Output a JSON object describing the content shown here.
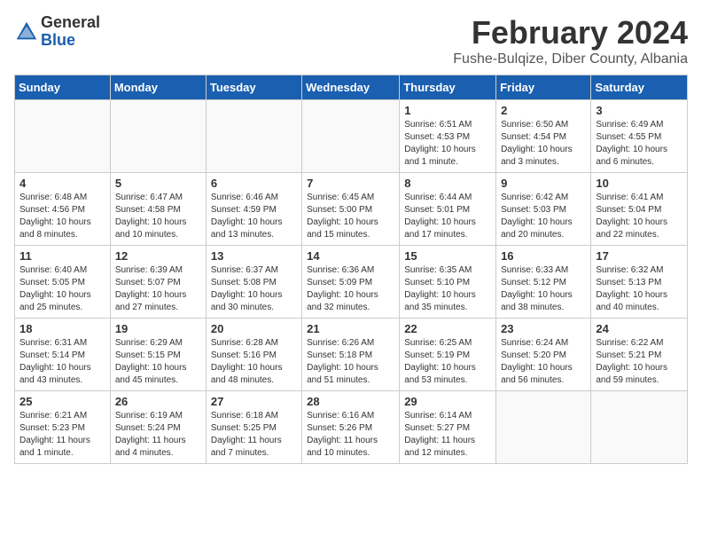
{
  "logo": {
    "general": "General",
    "blue": "Blue"
  },
  "title": "February 2024",
  "subtitle": "Fushe-Bulqize, Diber County, Albania",
  "days_of_week": [
    "Sunday",
    "Monday",
    "Tuesday",
    "Wednesday",
    "Thursday",
    "Friday",
    "Saturday"
  ],
  "weeks": [
    [
      {
        "day": "",
        "info": ""
      },
      {
        "day": "",
        "info": ""
      },
      {
        "day": "",
        "info": ""
      },
      {
        "day": "",
        "info": ""
      },
      {
        "day": "1",
        "info": "Sunrise: 6:51 AM\nSunset: 4:53 PM\nDaylight: 10 hours and 1 minute."
      },
      {
        "day": "2",
        "info": "Sunrise: 6:50 AM\nSunset: 4:54 PM\nDaylight: 10 hours and 3 minutes."
      },
      {
        "day": "3",
        "info": "Sunrise: 6:49 AM\nSunset: 4:55 PM\nDaylight: 10 hours and 6 minutes."
      }
    ],
    [
      {
        "day": "4",
        "info": "Sunrise: 6:48 AM\nSunset: 4:56 PM\nDaylight: 10 hours and 8 minutes."
      },
      {
        "day": "5",
        "info": "Sunrise: 6:47 AM\nSunset: 4:58 PM\nDaylight: 10 hours and 10 minutes."
      },
      {
        "day": "6",
        "info": "Sunrise: 6:46 AM\nSunset: 4:59 PM\nDaylight: 10 hours and 13 minutes."
      },
      {
        "day": "7",
        "info": "Sunrise: 6:45 AM\nSunset: 5:00 PM\nDaylight: 10 hours and 15 minutes."
      },
      {
        "day": "8",
        "info": "Sunrise: 6:44 AM\nSunset: 5:01 PM\nDaylight: 10 hours and 17 minutes."
      },
      {
        "day": "9",
        "info": "Sunrise: 6:42 AM\nSunset: 5:03 PM\nDaylight: 10 hours and 20 minutes."
      },
      {
        "day": "10",
        "info": "Sunrise: 6:41 AM\nSunset: 5:04 PM\nDaylight: 10 hours and 22 minutes."
      }
    ],
    [
      {
        "day": "11",
        "info": "Sunrise: 6:40 AM\nSunset: 5:05 PM\nDaylight: 10 hours and 25 minutes."
      },
      {
        "day": "12",
        "info": "Sunrise: 6:39 AM\nSunset: 5:07 PM\nDaylight: 10 hours and 27 minutes."
      },
      {
        "day": "13",
        "info": "Sunrise: 6:37 AM\nSunset: 5:08 PM\nDaylight: 10 hours and 30 minutes."
      },
      {
        "day": "14",
        "info": "Sunrise: 6:36 AM\nSunset: 5:09 PM\nDaylight: 10 hours and 32 minutes."
      },
      {
        "day": "15",
        "info": "Sunrise: 6:35 AM\nSunset: 5:10 PM\nDaylight: 10 hours and 35 minutes."
      },
      {
        "day": "16",
        "info": "Sunrise: 6:33 AM\nSunset: 5:12 PM\nDaylight: 10 hours and 38 minutes."
      },
      {
        "day": "17",
        "info": "Sunrise: 6:32 AM\nSunset: 5:13 PM\nDaylight: 10 hours and 40 minutes."
      }
    ],
    [
      {
        "day": "18",
        "info": "Sunrise: 6:31 AM\nSunset: 5:14 PM\nDaylight: 10 hours and 43 minutes."
      },
      {
        "day": "19",
        "info": "Sunrise: 6:29 AM\nSunset: 5:15 PM\nDaylight: 10 hours and 45 minutes."
      },
      {
        "day": "20",
        "info": "Sunrise: 6:28 AM\nSunset: 5:16 PM\nDaylight: 10 hours and 48 minutes."
      },
      {
        "day": "21",
        "info": "Sunrise: 6:26 AM\nSunset: 5:18 PM\nDaylight: 10 hours and 51 minutes."
      },
      {
        "day": "22",
        "info": "Sunrise: 6:25 AM\nSunset: 5:19 PM\nDaylight: 10 hours and 53 minutes."
      },
      {
        "day": "23",
        "info": "Sunrise: 6:24 AM\nSunset: 5:20 PM\nDaylight: 10 hours and 56 minutes."
      },
      {
        "day": "24",
        "info": "Sunrise: 6:22 AM\nSunset: 5:21 PM\nDaylight: 10 hours and 59 minutes."
      }
    ],
    [
      {
        "day": "25",
        "info": "Sunrise: 6:21 AM\nSunset: 5:23 PM\nDaylight: 11 hours and 1 minute."
      },
      {
        "day": "26",
        "info": "Sunrise: 6:19 AM\nSunset: 5:24 PM\nDaylight: 11 hours and 4 minutes."
      },
      {
        "day": "27",
        "info": "Sunrise: 6:18 AM\nSunset: 5:25 PM\nDaylight: 11 hours and 7 minutes."
      },
      {
        "day": "28",
        "info": "Sunrise: 6:16 AM\nSunset: 5:26 PM\nDaylight: 11 hours and 10 minutes."
      },
      {
        "day": "29",
        "info": "Sunrise: 6:14 AM\nSunset: 5:27 PM\nDaylight: 11 hours and 12 minutes."
      },
      {
        "day": "",
        "info": ""
      },
      {
        "day": "",
        "info": ""
      }
    ]
  ]
}
